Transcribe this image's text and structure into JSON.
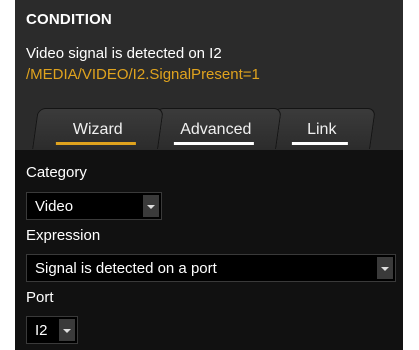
{
  "condition": {
    "title": "CONDITION",
    "description": "Video signal is detected on I2",
    "path": "/MEDIA/VIDEO/I2.SignalPresent=1"
  },
  "tabs": [
    {
      "label": "Wizard",
      "active": true
    },
    {
      "label": "Advanced",
      "active": false
    },
    {
      "label": "Link",
      "active": false
    }
  ],
  "form": {
    "category_label": "Category",
    "category_value": "Video",
    "expression_label": "Expression",
    "expression_value": "Signal is detected on a port",
    "port_label": "Port",
    "port_value": "I2"
  },
  "colors": {
    "accent": "#e0a31e",
    "panel_bg": "#2b2b2b",
    "form_bg": "#111111"
  },
  "icons": {
    "dropdown": "chevron-down-icon"
  }
}
